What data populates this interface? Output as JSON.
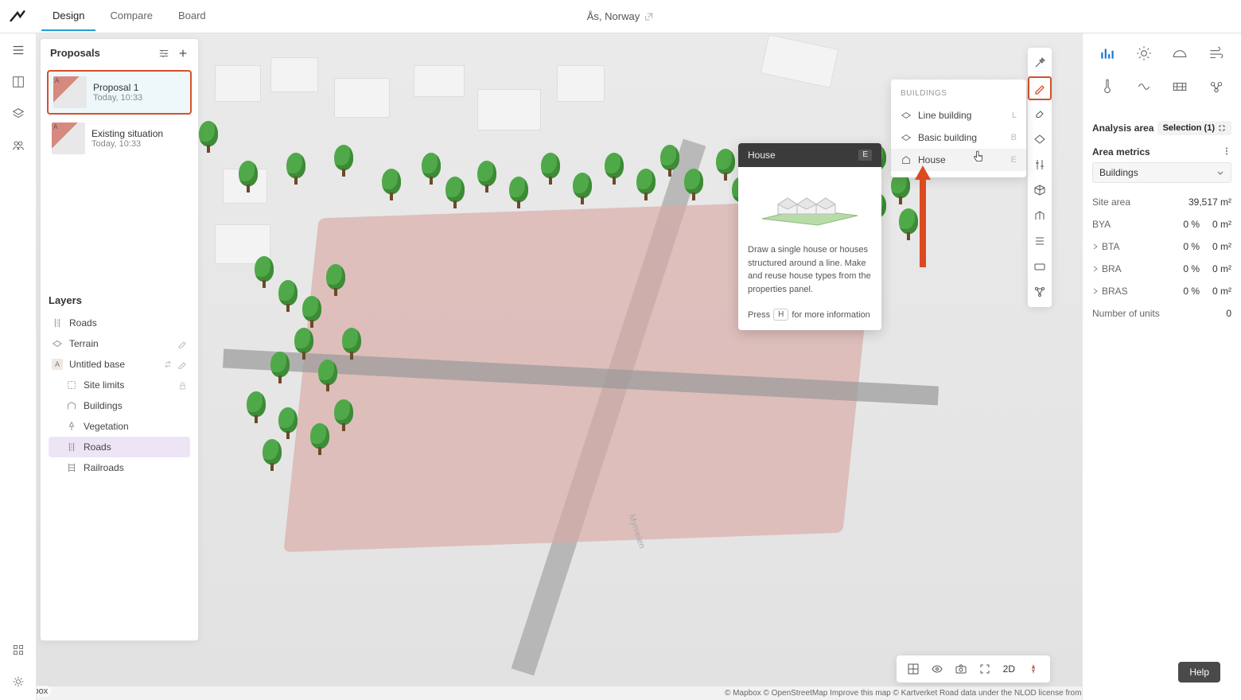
{
  "header": {
    "tabs": [
      "Design",
      "Compare",
      "Board"
    ],
    "active_tab": 0,
    "location": "Ås, Norway"
  },
  "proposals": {
    "title": "Proposals",
    "items": [
      {
        "title": "Proposal 1",
        "date": "Today, 10:33",
        "selected": true
      },
      {
        "title": "Existing situation",
        "date": "Today, 10:33",
        "selected": false
      }
    ]
  },
  "layers": {
    "title": "Layers",
    "items": [
      {
        "label": "Roads",
        "icon": "roads",
        "nested": false
      },
      {
        "label": "Terrain",
        "icon": "terrain",
        "nested": false,
        "actions": [
          "edit"
        ]
      },
      {
        "label": "Untitled base",
        "icon": "base",
        "nested": false,
        "actions": [
          "swap",
          "edit"
        ],
        "badge": "A"
      },
      {
        "label": "Site limits",
        "icon": "sitelimits",
        "nested": true,
        "actions": [
          "lock"
        ]
      },
      {
        "label": "Buildings",
        "icon": "buildings",
        "nested": true
      },
      {
        "label": "Vegetation",
        "icon": "vegetation",
        "nested": true
      },
      {
        "label": "Roads",
        "icon": "roads",
        "nested": true,
        "selected": true
      },
      {
        "label": "Railroads",
        "icon": "railroads",
        "nested": true
      }
    ]
  },
  "buildings_menu": {
    "title": "BUILDINGS",
    "items": [
      {
        "label": "Line building",
        "key": "L"
      },
      {
        "label": "Basic building",
        "key": "B"
      },
      {
        "label": "House",
        "key": "E",
        "hover": true
      }
    ]
  },
  "tooltip": {
    "title": "House",
    "key": "E",
    "body": "Draw a single house or houses structured around a line. Make and reuse house types from the properties panel.",
    "footer_pre": "Press",
    "footer_key": "H",
    "footer_post": "for more information"
  },
  "right_tools": [
    "magic-wand-icon",
    "pencil-icon",
    "paint-icon",
    "shape-icon",
    "adjust-icon",
    "cube-icon",
    "building3d-icon",
    "levels-icon",
    "keyboard-icon",
    "network-icon"
  ],
  "analysis": {
    "icons_row1": [
      "bar-chart-icon",
      "sun-icon",
      "dome-icon",
      "wind-icon",
      "thermometer-icon"
    ],
    "icons_row2": [
      "noise-icon",
      "solar-panel-icon",
      "micro-climate-icon"
    ],
    "area_title": "Analysis area",
    "selection_label": "Selection (1)",
    "metrics_title": "Area metrics",
    "dropdown": "Buildings",
    "rows": [
      {
        "label": "Site area",
        "pct": "",
        "val": "39,517 m²"
      },
      {
        "label": "BYA",
        "pct": "0 %",
        "val": "0 m²"
      },
      {
        "label": "BTA",
        "pct": "0 %",
        "val": "0 m²",
        "expandable": true
      },
      {
        "label": "BRA",
        "pct": "0 %",
        "val": "0 m²",
        "expandable": true
      },
      {
        "label": "BRAS",
        "pct": "0 %",
        "val": "0 m²",
        "expandable": true
      },
      {
        "label": "Number of units",
        "pct": "",
        "val": "0"
      }
    ]
  },
  "bottombar": {
    "mode": "2D"
  },
  "help_label": "Help",
  "canvas": {
    "road_label": "Myrveien"
  },
  "attribution": {
    "left": "© mapbox",
    "right": "© Mapbox © OpenStreetMap Improve this map © Kartverket Road data under the NLOD license from the Norwegian Public Roads Administration"
  }
}
